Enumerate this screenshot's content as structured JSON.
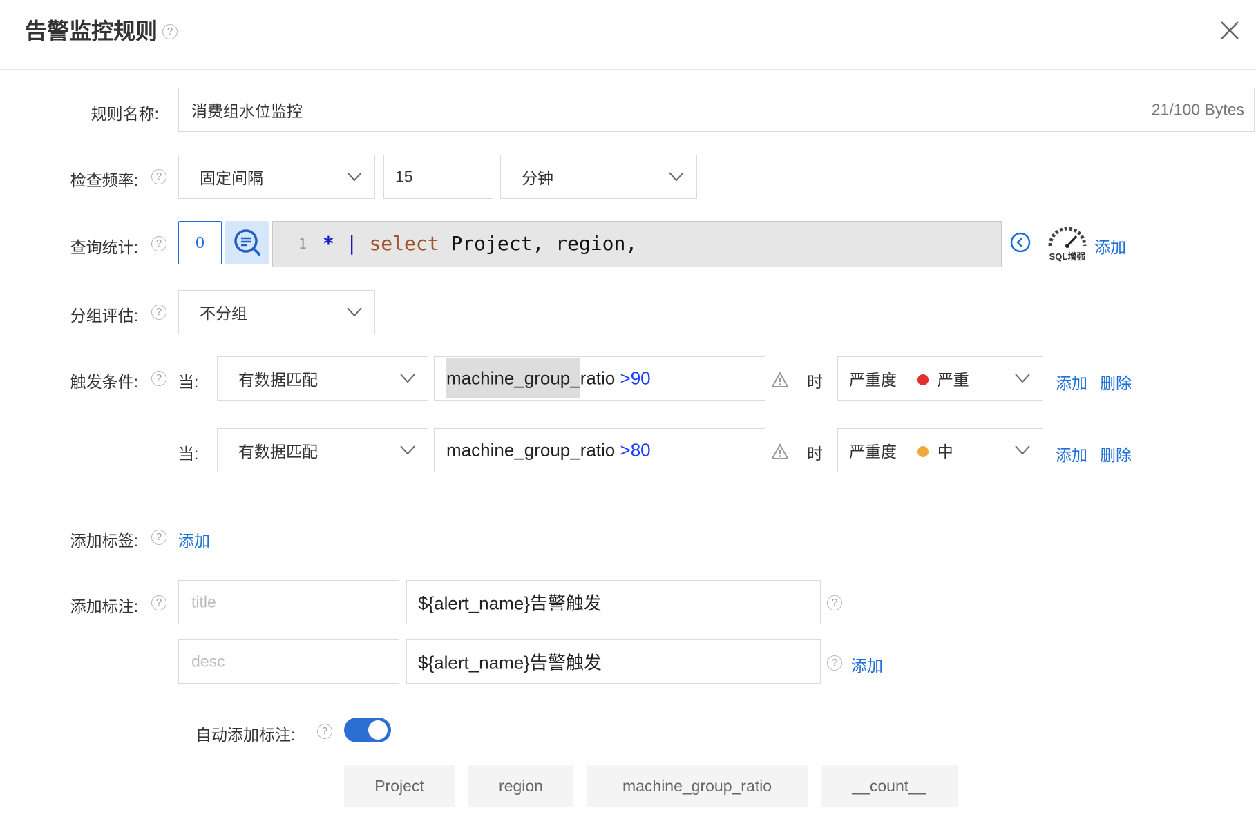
{
  "dialog": {
    "title": "告警监控规则",
    "help_glyph": "?"
  },
  "rule_name": {
    "label": "规则名称:",
    "value": "消费组水位监控",
    "counter": "21/100 Bytes"
  },
  "frequency": {
    "label": "检查频率:",
    "type_value": "固定间隔",
    "interval_value": "15",
    "unit_value": "分钟"
  },
  "query": {
    "label": "查询统计:",
    "index_value": "0",
    "line_number": "1",
    "code_star": "*",
    "code_pipe": "|",
    "code_keyword": "select",
    "code_rest": "Project, region,",
    "sql_enhance_label": "SQL增强",
    "add_label": "添加"
  },
  "grouping": {
    "label": "分组评估:",
    "value": "不分组"
  },
  "trigger": {
    "label": "触发条件:",
    "when_label": "当:",
    "then_label": "时",
    "severity_label": "严重度",
    "add_label": "添加",
    "delete_label": "删除",
    "conditions": [
      {
        "match": "有数据匹配",
        "field": "machine_group_ratio",
        "op": ">",
        "threshold": "90",
        "severity": "严重",
        "severity_color": "#e0312e"
      },
      {
        "match": "有数据匹配",
        "field": "machine_group_ratio",
        "op": ">",
        "threshold": "80",
        "severity": "中",
        "severity_color": "#f0a93c"
      }
    ]
  },
  "labels": {
    "label": "添加标签:",
    "add_label": "添加"
  },
  "annotations": {
    "label": "添加标注:",
    "rows": [
      {
        "key_placeholder": "title",
        "value": "${alert_name}告警触发"
      },
      {
        "key_placeholder": "desc",
        "value": "${alert_name}告警触发"
      }
    ],
    "add_label": "添加"
  },
  "auto_annotation": {
    "label": "自动添加标注:",
    "enabled": true
  },
  "fields": [
    "Project",
    "region",
    "machine_group_ratio",
    "__count__"
  ],
  "colors": {
    "accent": "#1e6fd9",
    "toggle_on": "#2b6ed4",
    "border": "#dcdcdc"
  }
}
